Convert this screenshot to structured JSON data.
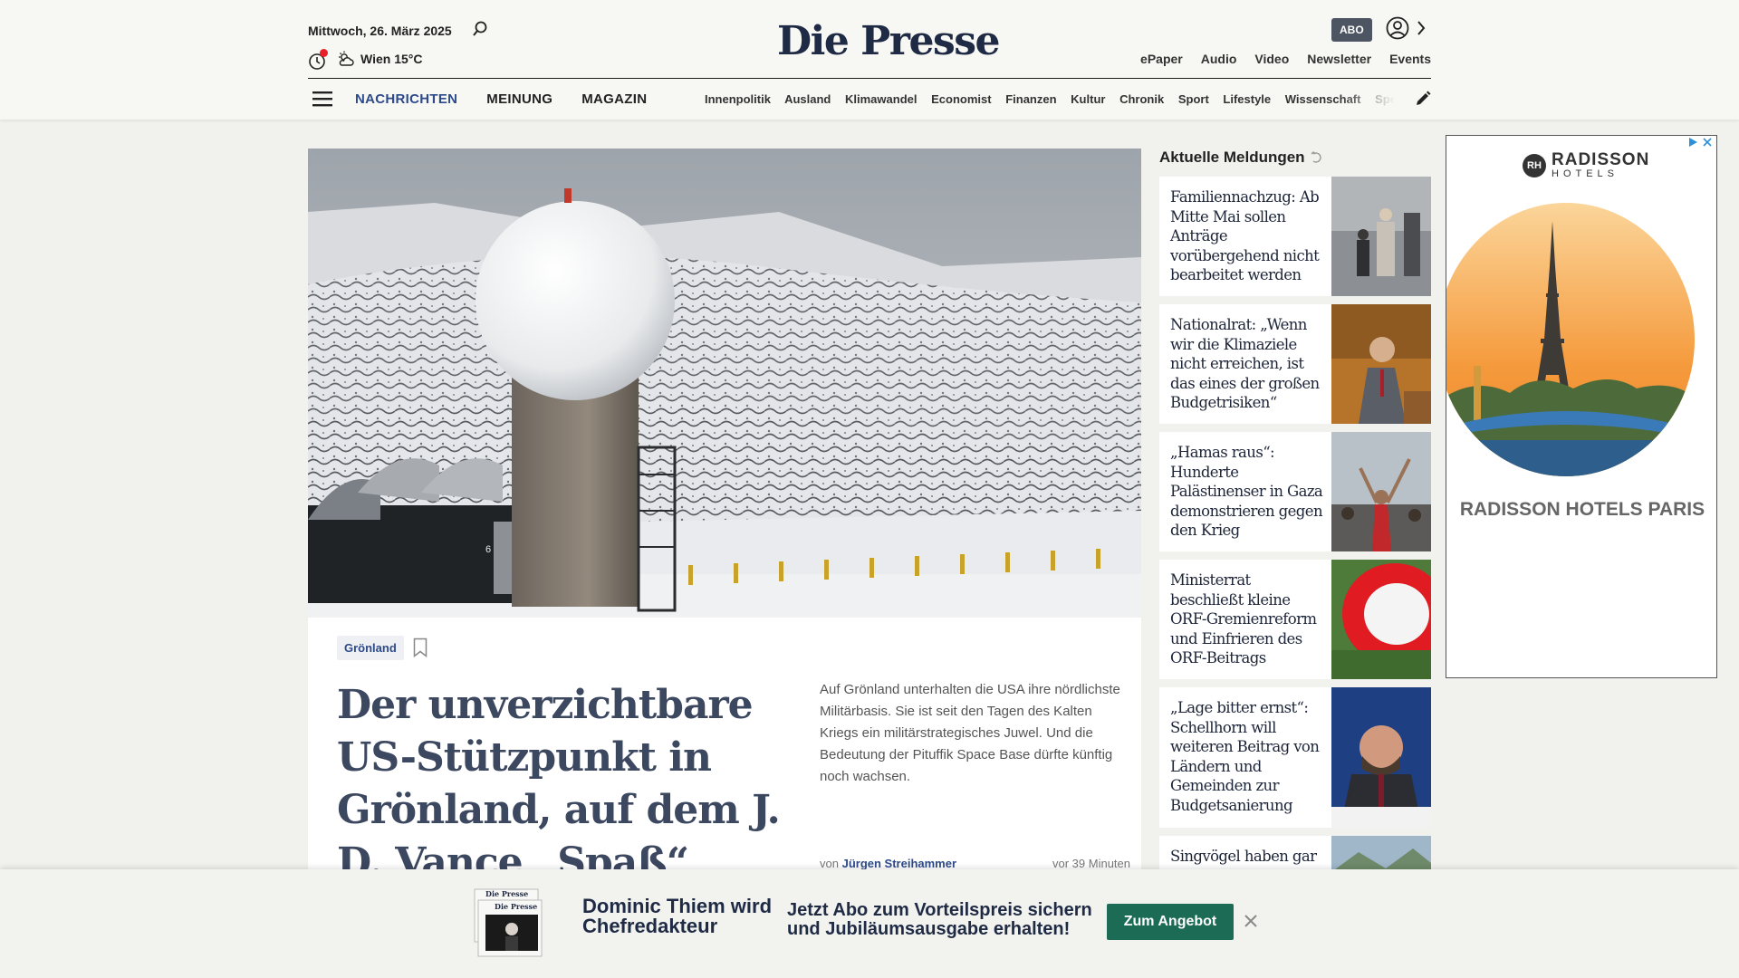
{
  "header": {
    "date": "Mittwoch, 26. März 2025",
    "weather": "Wien 15°C",
    "logo": "Die Presse",
    "abo_label": "ABO",
    "top_links": [
      "ePaper",
      "Audio",
      "Video",
      "Newsletter",
      "Events"
    ],
    "main_nav": [
      "NACHRICHTEN",
      "MEINUNG",
      "MAGAZIN"
    ],
    "sub_nav": [
      "Innenpolitik",
      "Ausland",
      "Klimawandel",
      "Economist",
      "Finanzen",
      "Kultur",
      "Chronik",
      "Sport",
      "Lifestyle",
      "Wissenschaft",
      "Spectrum"
    ],
    "colors": {
      "accent": "#2d4a8a",
      "logo": "#1f2a44"
    }
  },
  "hero": {
    "tag": "Grönland",
    "headline": "Der unverzichtbare US-Stützpunkt in Grönland, auf dem J. D. Vance „Spaß“ haben will",
    "teaser": "Auf Grönland unterhalten die USA ihre nördlichste Militärbasis. Sie ist seit den Tagen des Kalten Kriegs ein militärstrategisches Juwel. Und die Bedeutung der Pituffik Space Base dürfte künftig noch wachsen.",
    "author_prefix": "von",
    "author": "Jürgen Streihammer",
    "age": "vor 39 Minuten",
    "image_number": "6"
  },
  "news": {
    "title": "Aktuelle Meldungen",
    "items": [
      {
        "text": "Familiennachzug: Ab Mitte Mai sollen Anträge vorübergehend nicht bearbeitet werden"
      },
      {
        "text": "Nationalrat: „Wenn wir die Klimaziele nicht erreichen, ist das eines der großen Budgetrisiken“"
      },
      {
        "text": "„Hamas raus“: Hunderte Palästinenser in Gaza demonstrieren gegen den Krieg"
      },
      {
        "text": "Ministerrat beschließt kleine ORF-Gremienreform und Einfrieren des ORF-Beitrags"
      },
      {
        "text": "„Lage bitter ernst“: Schellhorn will weiteren Beitrag von Ländern und Gemeinden zur Budgetsanierung"
      },
      {
        "text": "Singvögel haben gar kein Heißhunger"
      }
    ]
  },
  "ad": {
    "brand_short": "RH",
    "brand": "RADISSON",
    "brand_sub": "HOTELS",
    "caption": "RADISSON HOTELS PARIS"
  },
  "banner": {
    "headline": "Dominic Thiem wird Chefredakteur",
    "offer": "Jetzt Abo zum Vorteilspreis sichern und Jubiläumsausgabe erhalten!",
    "cta": "Zum Angebot",
    "paper_logo": "Die Presse",
    "cta_color": "#1c6b55"
  }
}
